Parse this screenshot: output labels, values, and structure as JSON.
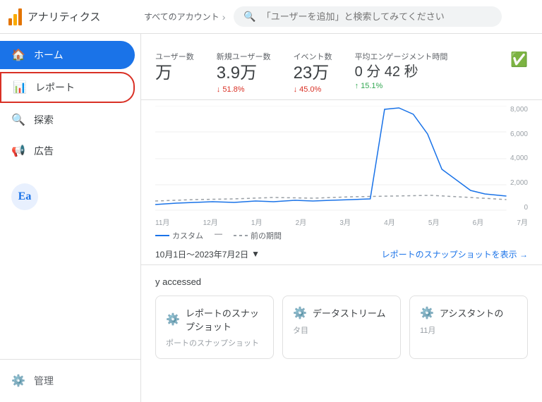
{
  "app": {
    "logo_label": "アナリティクス",
    "breadcrumb_text": "すべてのアカウント",
    "search_placeholder": "「ユーザーを追加」と検索してみてください"
  },
  "sidebar": {
    "items": [
      {
        "id": "home",
        "label": "ホーム",
        "icon": "🏠",
        "active": true,
        "highlighted": false
      },
      {
        "id": "report",
        "label": "レポート",
        "icon": "📊",
        "active": false,
        "highlighted": true
      },
      {
        "id": "explore",
        "label": "探索",
        "icon": "🔍",
        "active": false,
        "highlighted": false
      },
      {
        "id": "ads",
        "label": "広告",
        "icon": "📢",
        "active": false,
        "highlighted": false
      }
    ],
    "bottom_items": [
      {
        "id": "admin",
        "label": "管理",
        "icon": "⚙️"
      }
    ]
  },
  "metrics": {
    "tabs": [
      "ユーザー",
      "新規ユーザー数",
      "イベント数",
      "平均エンゲージメント時間"
    ],
    "items": [
      {
        "label": "新規ユーザー数",
        "value": "3.9万",
        "change": "↓ 51.8%",
        "direction": "down"
      },
      {
        "label": "イベント数",
        "value": "23万",
        "change": "↓ 45.0%",
        "direction": "down"
      },
      {
        "label": "平均エンゲージメント時間",
        "value": "0 分 42 秒",
        "change": "↑ 15.1%",
        "direction": "up"
      }
    ]
  },
  "chart": {
    "x_labels": [
      "11月",
      "12月",
      "1月",
      "2月",
      "3月",
      "4月",
      "5月",
      "6月",
      "7月"
    ],
    "y_labels": [
      "8,000",
      "6,000",
      "4,000",
      "2,000",
      "0"
    ],
    "legend": {
      "current": "カスタム",
      "previous": "前の期間"
    }
  },
  "date_range": {
    "label": "10月1日〜2023年7月2日",
    "chevron": "▼",
    "snapshot_link": "レポートのスナップショットを表示 →"
  },
  "recently": {
    "title": "y accessed",
    "cards": [
      {
        "icon": "⚙️",
        "title": "レポートのスナップショット",
        "desc": "ポートのスナップショット",
        "sub": ""
      },
      {
        "icon": "⚙️",
        "title": "データストリーム",
        "desc": "タ目",
        "sub": ""
      },
      {
        "icon": "⚙️",
        "title": "アシスタントの",
        "desc": "11月",
        "sub": ""
      }
    ]
  },
  "avatar": {
    "initials": "Ea"
  }
}
